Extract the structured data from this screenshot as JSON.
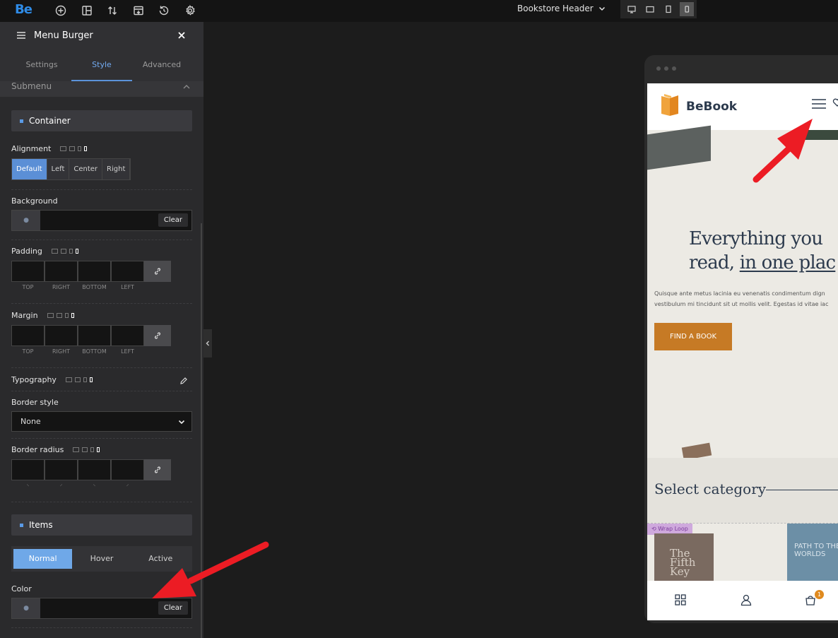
{
  "topbar": {
    "logo": "Be",
    "page_name": "Bookstore Header",
    "tools": [
      "add-icon",
      "structure-icon",
      "sort-icon",
      "export-icon",
      "history-icon",
      "gear-icon"
    ],
    "devices": [
      "desktop",
      "tablet-landscape",
      "tablet",
      "mobile"
    ],
    "active_device": "mobile"
  },
  "panel": {
    "title": "Menu Burger",
    "tabs": [
      "Settings",
      "Style",
      "Advanced"
    ],
    "active_tab": "Style",
    "section": "Submenu",
    "container": {
      "title": "Container",
      "alignment_label": "Alignment",
      "alignment_options": [
        "Default",
        "Left",
        "Center",
        "Right"
      ],
      "alignment_selected": "Default",
      "background_label": "Background",
      "clear_label": "Clear",
      "padding_label": "Padding",
      "margin_label": "Margin",
      "side_labels": [
        "TOP",
        "RIGHT",
        "BOTTOM",
        "LEFT"
      ],
      "typography_label": "Typography",
      "border_style_label": "Border style",
      "border_style_value": "None",
      "border_radius_label": "Border radius"
    },
    "items": {
      "title": "Items",
      "states": [
        "Normal",
        "Hover",
        "Active"
      ],
      "state_selected": "Normal",
      "color_label": "Color",
      "clear_label": "Clear"
    }
  },
  "preview": {
    "brand": "BeBook",
    "hero_title_1": "Everything you",
    "hero_title_2a": "read, ",
    "hero_title_2b": "in one plac",
    "hero_text_1": "Quisque ante metus lacinia eu venenatis condimentum dign",
    "hero_text_2": "vestibulum mi tincidunt sit ut mollis velit. Egestas id vitae iac",
    "cta": "FIND A BOOK",
    "category_title": "Select category",
    "wrap_label": "Wrap Loop",
    "book1_title": "The Fifth Key",
    "book2_title": "PATH TO THE WORLDS",
    "cart_count": "1",
    "accent": "#c67a25"
  }
}
